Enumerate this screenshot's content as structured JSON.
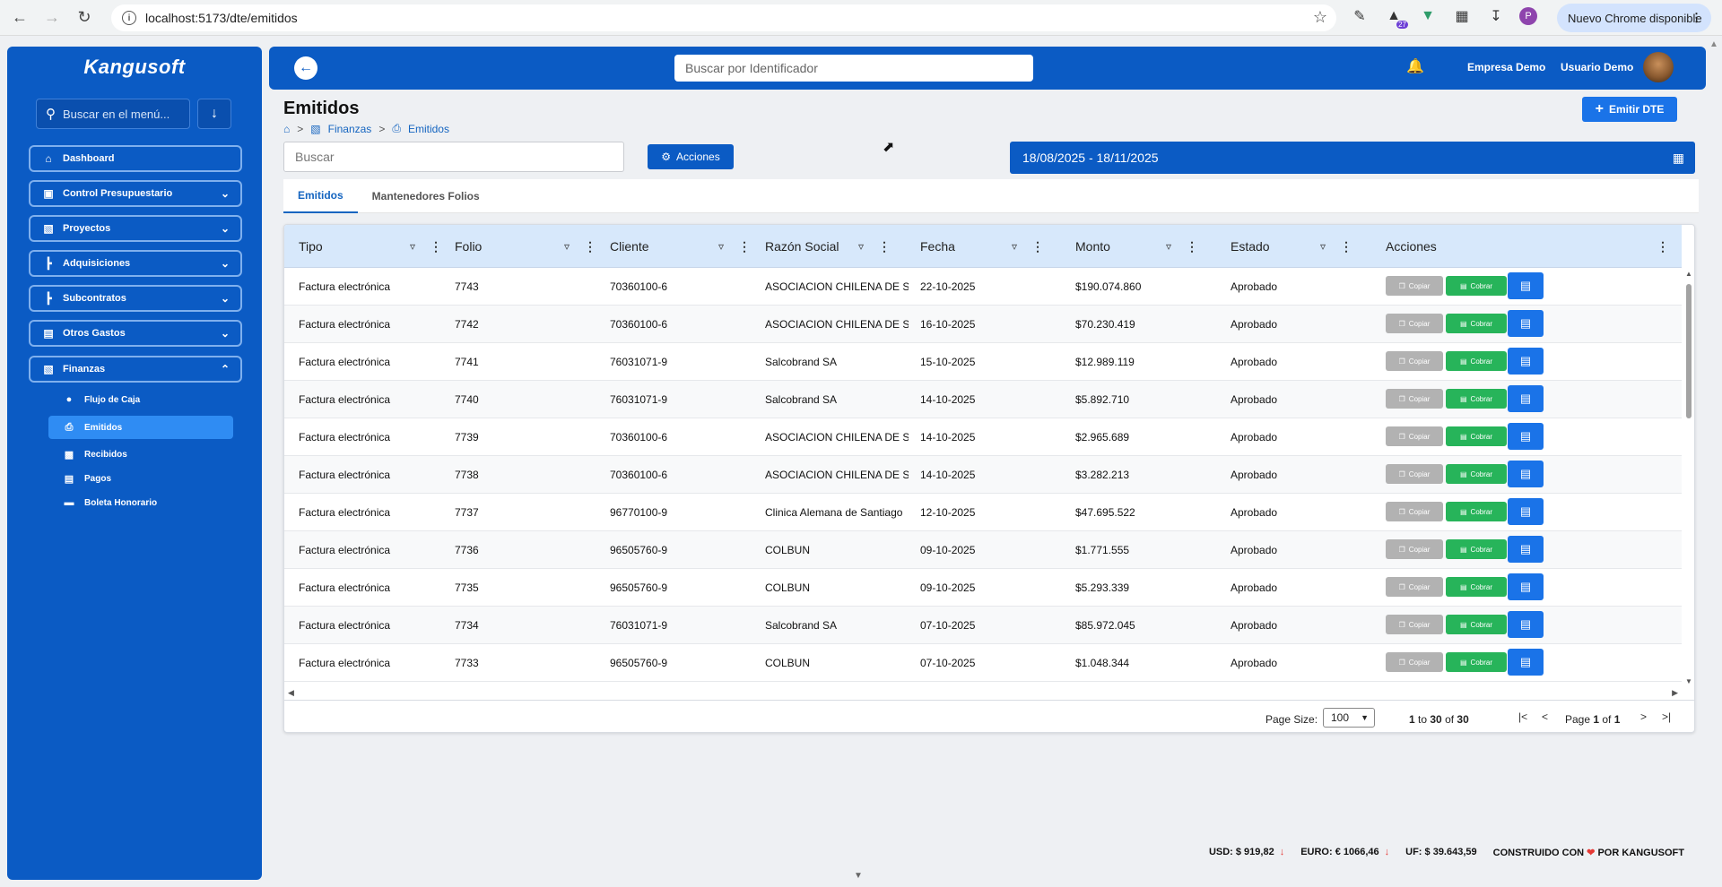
{
  "browser": {
    "url": "localhost:5173/dte/emitidos",
    "update_label": "Nuevo Chrome disponible",
    "profile_initial": "P",
    "ext_badge": "27"
  },
  "sidebar": {
    "logo": "Kangusoft",
    "search_placeholder": "Buscar en el menú...",
    "items": [
      {
        "label": "Dashboard",
        "icon": "home-icon"
      },
      {
        "label": "Control Presupuestario",
        "icon": "monitor-icon"
      },
      {
        "label": "Proyectos",
        "icon": "folder-icon"
      },
      {
        "label": "Adquisiciones",
        "icon": "tree-icon"
      },
      {
        "label": "Subcontratos",
        "icon": "tree-icon"
      },
      {
        "label": "Otros Gastos",
        "icon": "money-icon"
      },
      {
        "label": "Finanzas",
        "icon": "folder-icon"
      }
    ],
    "subitems": [
      {
        "label": "Flujo de Caja",
        "icon": "coins-icon"
      },
      {
        "label": "Emitidos",
        "icon": "printer-icon"
      },
      {
        "label": "Recibidos",
        "icon": "file-icon"
      },
      {
        "label": "Pagos",
        "icon": "money-icon"
      },
      {
        "label": "Boleta Honorario",
        "icon": "receipt-icon"
      }
    ]
  },
  "header": {
    "search_placeholder": "Buscar por Identificador",
    "company": "Empresa Demo",
    "user": "Usuario Demo"
  },
  "page": {
    "title": "Emitidos",
    "breadcrumb": [
      "Finanzas",
      "Emitidos"
    ],
    "emit_button": "Emitir DTE",
    "search_placeholder": "Buscar",
    "actions_button": "Acciones",
    "date_range": "18/08/2025 - 18/11/2025",
    "tabs": [
      "Emitidos",
      "Mantenedores Folios"
    ]
  },
  "grid": {
    "columns": [
      "Tipo",
      "Folio",
      "Cliente",
      "Razón Social",
      "Fecha",
      "Monto",
      "Estado",
      "Acciones"
    ],
    "row_buttons": {
      "copy": "Copiar",
      "charge": "Cobrar"
    },
    "rows": [
      {
        "tipo": "Factura electrónica",
        "folio": "7743",
        "cliente": "70360100-6",
        "razon": "ASOCIACION CHILENA DE SE",
        "fecha": "22-10-2025",
        "monto": "$190.074.860",
        "estado": "Aprobado"
      },
      {
        "tipo": "Factura electrónica",
        "folio": "7742",
        "cliente": "70360100-6",
        "razon": "ASOCIACION CHILENA DE SE",
        "fecha": "16-10-2025",
        "monto": "$70.230.419",
        "estado": "Aprobado"
      },
      {
        "tipo": "Factura electrónica",
        "folio": "7741",
        "cliente": "76031071-9",
        "razon": "Salcobrand SA",
        "fecha": "15-10-2025",
        "monto": "$12.989.119",
        "estado": "Aprobado"
      },
      {
        "tipo": "Factura electrónica",
        "folio": "7740",
        "cliente": "76031071-9",
        "razon": "Salcobrand SA",
        "fecha": "14-10-2025",
        "monto": "$5.892.710",
        "estado": "Aprobado"
      },
      {
        "tipo": "Factura electrónica",
        "folio": "7739",
        "cliente": "70360100-6",
        "razon": "ASOCIACION CHILENA DE SE",
        "fecha": "14-10-2025",
        "monto": "$2.965.689",
        "estado": "Aprobado"
      },
      {
        "tipo": "Factura electrónica",
        "folio": "7738",
        "cliente": "70360100-6",
        "razon": "ASOCIACION CHILENA DE SE",
        "fecha": "14-10-2025",
        "monto": "$3.282.213",
        "estado": "Aprobado"
      },
      {
        "tipo": "Factura electrónica",
        "folio": "7737",
        "cliente": "96770100-9",
        "razon": "Clinica Alemana de Santiago",
        "fecha": "12-10-2025",
        "monto": "$47.695.522",
        "estado": "Aprobado"
      },
      {
        "tipo": "Factura electrónica",
        "folio": "7736",
        "cliente": "96505760-9",
        "razon": "COLBUN",
        "fecha": "09-10-2025",
        "monto": "$1.771.555",
        "estado": "Aprobado"
      },
      {
        "tipo": "Factura electrónica",
        "folio": "7735",
        "cliente": "96505760-9",
        "razon": "COLBUN",
        "fecha": "09-10-2025",
        "monto": "$5.293.339",
        "estado": "Aprobado"
      },
      {
        "tipo": "Factura electrónica",
        "folio": "7734",
        "cliente": "76031071-9",
        "razon": "Salcobrand SA",
        "fecha": "07-10-2025",
        "monto": "$85.972.045",
        "estado": "Aprobado"
      },
      {
        "tipo": "Factura electrónica",
        "folio": "7733",
        "cliente": "96505760-9",
        "razon": "COLBUN",
        "fecha": "07-10-2025",
        "monto": "$1.048.344",
        "estado": "Aprobado"
      }
    ],
    "page_size_label": "Page Size:",
    "page_size": "100",
    "rows_from": "1",
    "rows_to": "30",
    "rows_total": "30",
    "page_current": "1",
    "page_total": "1"
  },
  "footer": {
    "usd": "USD: $ 919,82",
    "euro": "EURO: € 1066,46",
    "uf": "UF: $ 39.643,59",
    "built_prefix": "CONSTRUIDO CON",
    "built_suffix": "POR KANGUSOFT"
  },
  "colors": {
    "primary": "#0b5bc4",
    "accent": "#1a73e8",
    "success": "#27b45a",
    "muted": "#b2b2b2",
    "header_row": "#d7e8fb"
  }
}
